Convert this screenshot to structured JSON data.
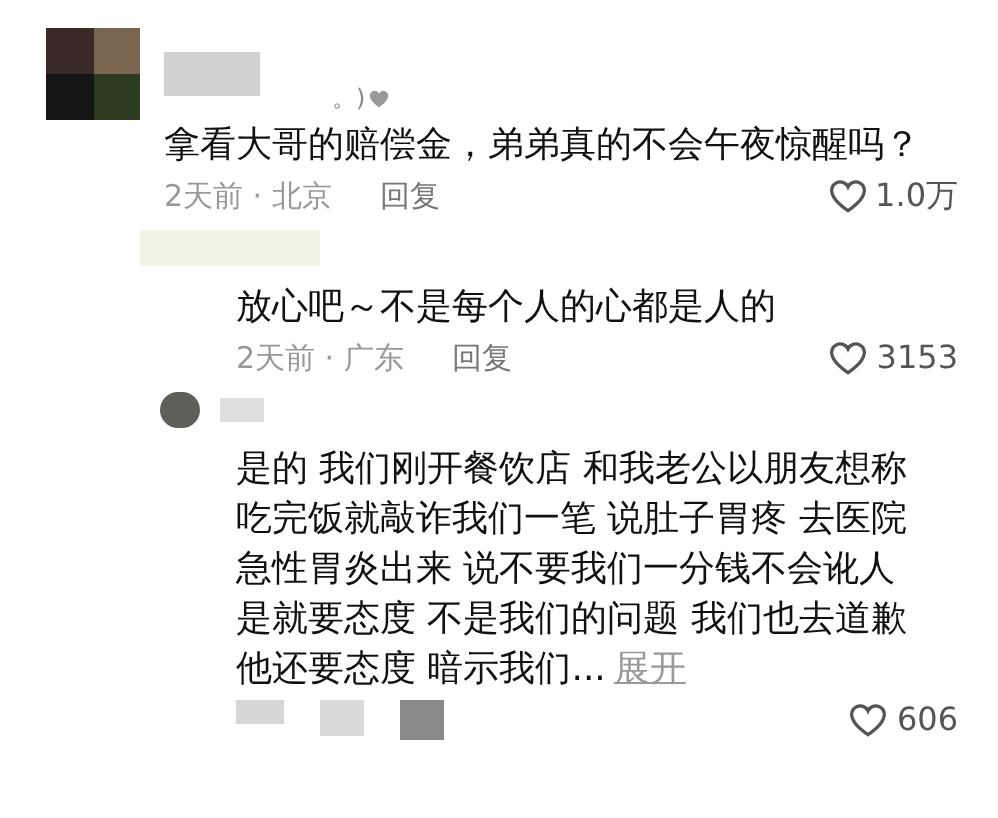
{
  "comments": [
    {
      "kind": "top",
      "name_suffix": "。)",
      "text_lines": [
        "拿看大哥的赔偿金，弟弟真的不会午夜惊醒吗？"
      ],
      "time_place": "2天前 · 北京",
      "reply": "回复",
      "likes": "1.0万"
    },
    {
      "kind": "reply",
      "text_lines": [
        "放心吧～不是每个人的心都是人的"
      ],
      "time_place": "2天前 · 广东",
      "reply": "回复",
      "likes": "3153"
    },
    {
      "kind": "nested",
      "text_lines": [
        "是的 我们刚开餐饮店 和我老公以朋友想称",
        "吃完饭就敲诈我们一笔 说肚子胃疼 去医院",
        "急性胃炎出来 说不要我们一分钱不会讹人",
        "是就要态度 不是我们的问题 我们也去道歉",
        "他还要态度 暗示我们..."
      ],
      "expand": "展开",
      "likes": "606"
    }
  ]
}
